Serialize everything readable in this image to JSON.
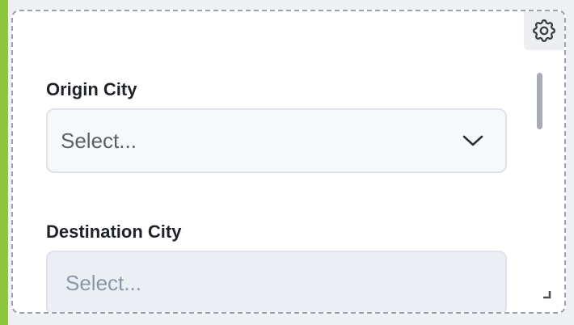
{
  "form": {
    "origin": {
      "label": "Origin City",
      "placeholder": "Select..."
    },
    "destination": {
      "label": "Destination City",
      "placeholder": "Select..."
    }
  },
  "icons": {
    "settings": "gear-icon",
    "dropdown": "chevron-down-icon",
    "resize": "resize-handle-icon"
  },
  "colors": {
    "accent": "#8cc63f"
  }
}
